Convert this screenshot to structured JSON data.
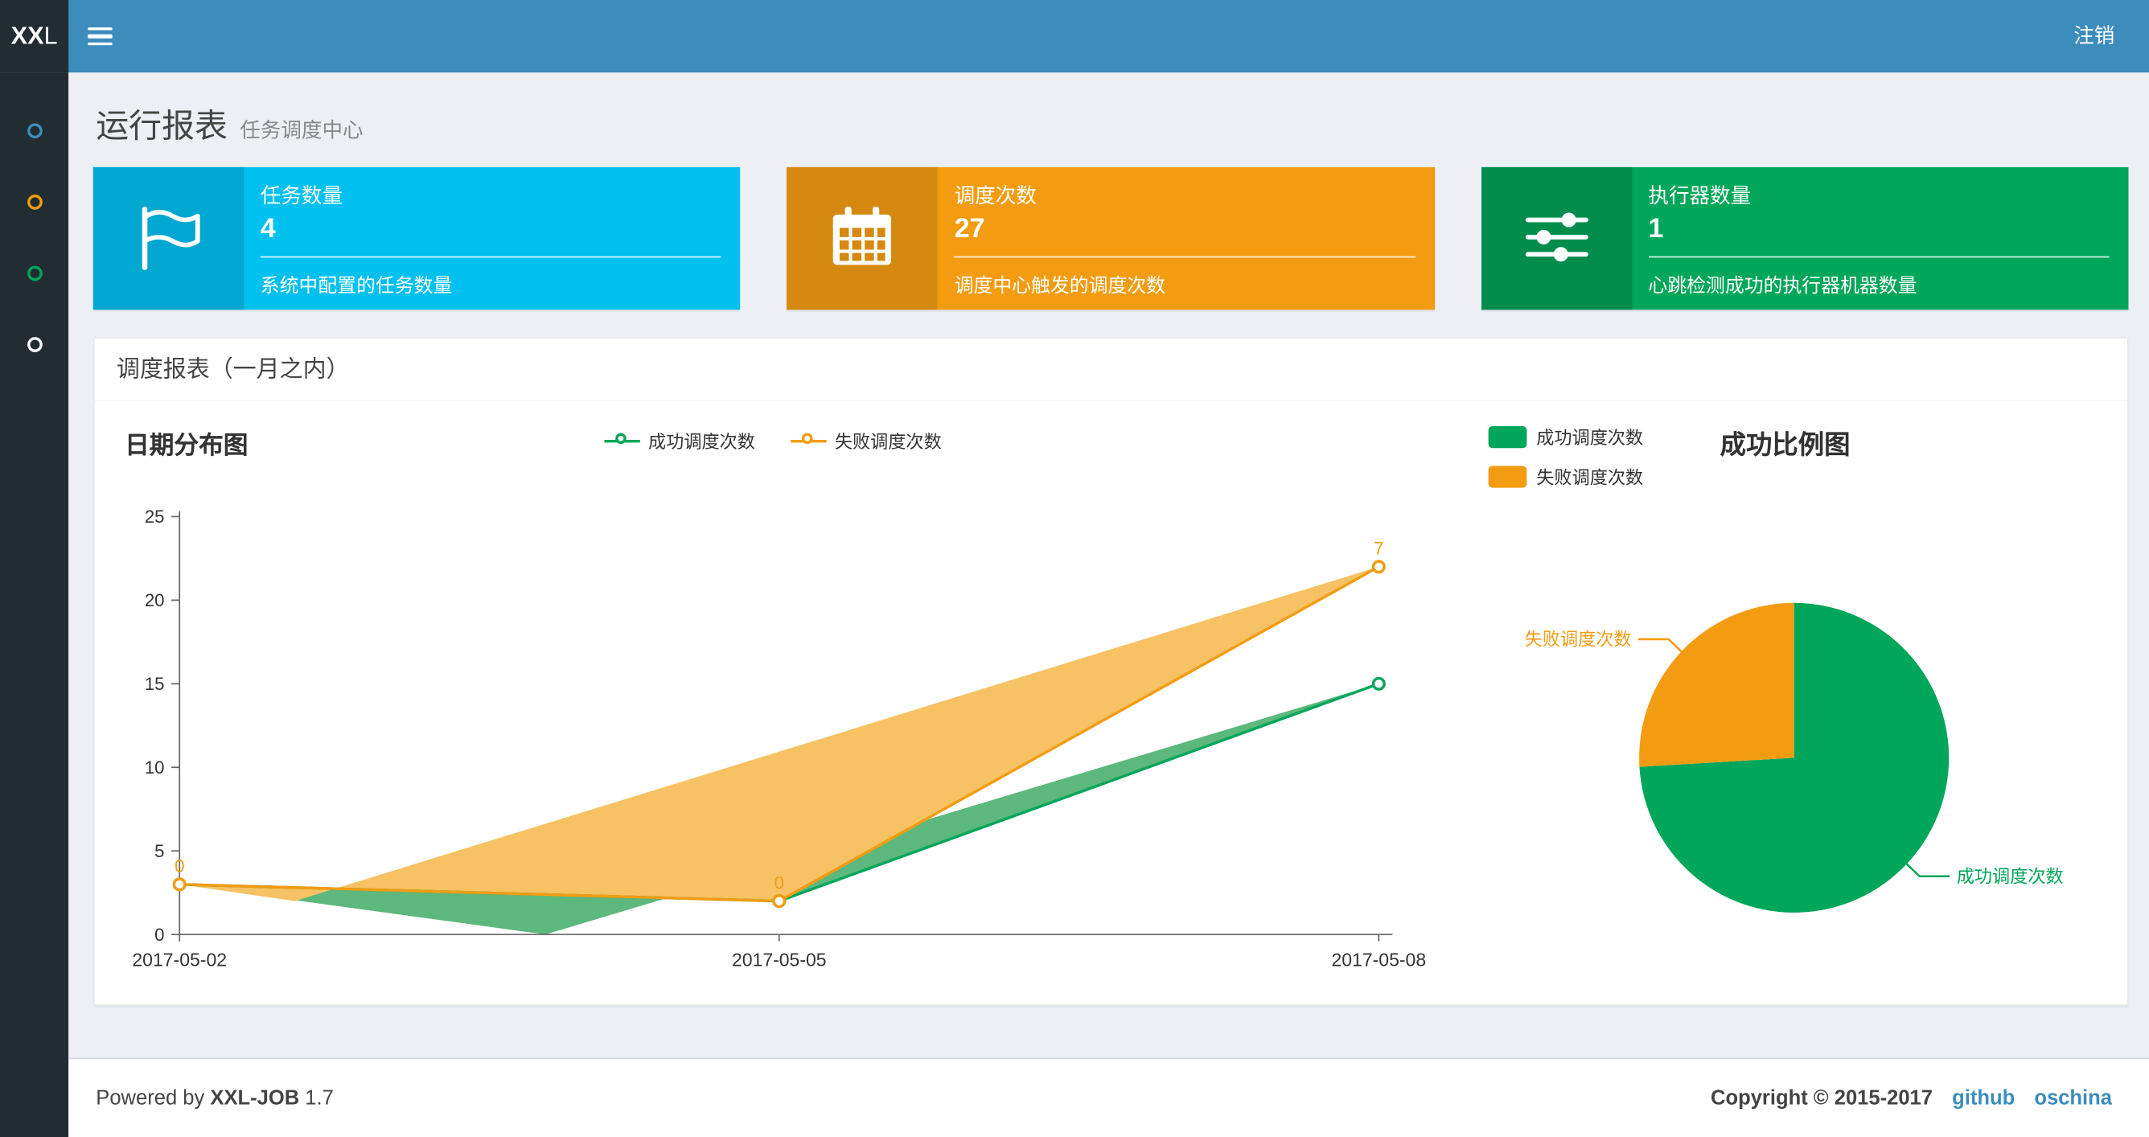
{
  "app": {
    "logo_bold": "XX",
    "logo_light": "L"
  },
  "navbar": {
    "logout": "注销",
    "menu_icon": "hamburger-menu-icon"
  },
  "sidebar": {
    "items": [
      {
        "label": "menu-item-1",
        "color": "#3c8dbc"
      },
      {
        "label": "menu-item-2",
        "color": "#f39c12"
      },
      {
        "label": "menu-item-3",
        "color": "#00a65a"
      },
      {
        "label": "menu-item-4",
        "color": "#ffffff"
      }
    ]
  },
  "header": {
    "title": "运行报表",
    "subtitle": "任务调度中心"
  },
  "info_boxes": [
    {
      "label": "任务数量",
      "value": "4",
      "desc": "系统中配置的任务数量",
      "icon": "flag-icon",
      "bg": "#00c0ef",
      "icon_bg": "#00a7d0"
    },
    {
      "label": "调度次数",
      "value": "27",
      "desc": "调度中心触发的调度次数",
      "icon": "calendar-icon",
      "bg": "#f39c12",
      "icon_bg": "#d68910"
    },
    {
      "label": "执行器数量",
      "value": "1",
      "desc": "心跳检测成功的执行器机器数量",
      "icon": "sliders-icon",
      "bg": "#00a65a",
      "icon_bg": "#008d4c"
    }
  ],
  "panel": {
    "title": "调度报表（一月之内）"
  },
  "chart_data": [
    {
      "type": "area",
      "title": "日期分布图",
      "x": [
        "2017-05-02",
        "2017-05-05",
        "2017-05-08"
      ],
      "stacked": true,
      "ylim": [
        0,
        25
      ],
      "yticks": [
        0,
        5,
        10,
        15,
        20,
        25
      ],
      "legend": [
        "成功调度次数",
        "失败调度次数"
      ],
      "legend_position": "top-center",
      "series": [
        {
          "name": "成功调度次数",
          "values": [
            3,
            2,
            15
          ],
          "color": "#00a65a",
          "area_color": "#5cb87c",
          "show_labels": false
        },
        {
          "name": "失败调度次数",
          "values": [
            0,
            0,
            7
          ],
          "color": "#f39c12",
          "area_color": "#f6c264",
          "show_labels": true
        }
      ]
    },
    {
      "type": "pie",
      "title": "成功比例图",
      "legend": [
        "成功调度次数",
        "失败调度次数"
      ],
      "legend_position": "top-left",
      "slices": [
        {
          "name": "成功调度次数",
          "value": 20,
          "color": "#00a65a"
        },
        {
          "name": "失败调度次数",
          "value": 7,
          "color": "#f39c12"
        }
      ]
    }
  ],
  "footer": {
    "powered_prefix": "Powered by",
    "product": "XXL-JOB",
    "version": "1.7",
    "copyright": "Copyright © 2015-2017",
    "links": [
      "github",
      "oschina"
    ]
  },
  "colors": {
    "navbar": "#3c8dbc",
    "logo_bg": "#222d32",
    "sidebar_bg": "#222d32",
    "content_bg": "#ecf0f5",
    "success_green": "#00a65a",
    "fail_orange": "#f39c12",
    "link_blue": "#3c8dbc"
  }
}
